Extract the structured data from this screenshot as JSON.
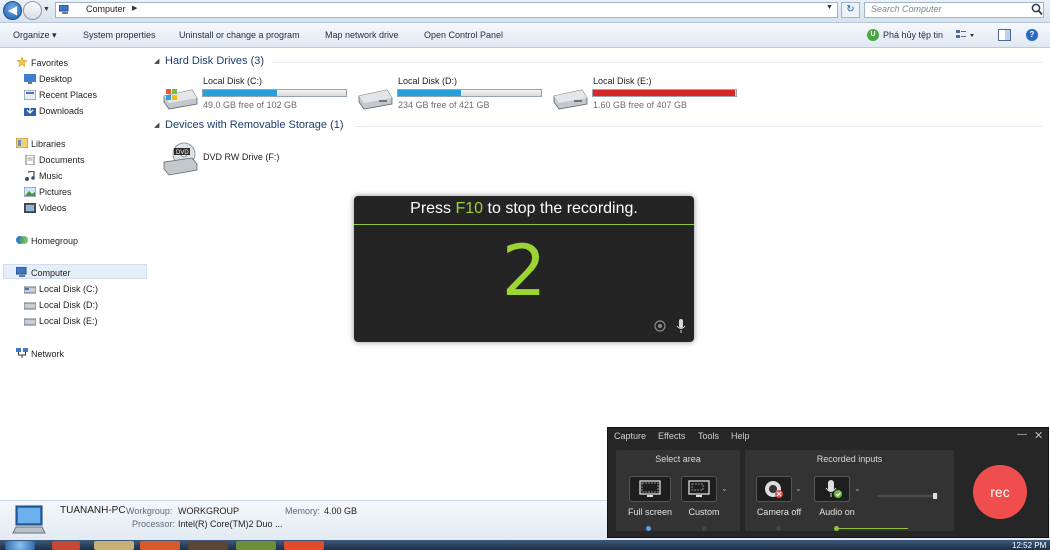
{
  "address_bar": {
    "path": "Computer",
    "search_placeholder": "Search Computer"
  },
  "command_bar": {
    "organize": "Organize",
    "system_properties": "System properties",
    "uninstall": "Uninstall or change a program",
    "map_drive": "Map network drive",
    "control_panel": "Open Control Panel",
    "extra": "Phá hủy tệp tin"
  },
  "nav": {
    "favorites": "Favorites",
    "desktop": "Desktop",
    "recent_places": "Recent Places",
    "downloads": "Downloads",
    "libraries": "Libraries",
    "documents": "Documents",
    "music": "Music",
    "pictures": "Pictures",
    "videos": "Videos",
    "homegroup": "Homegroup",
    "computer": "Computer",
    "disk_c": "Local Disk (C:)",
    "disk_d": "Local Disk (D:)",
    "disk_e": "Local Disk (E:)",
    "network": "Network"
  },
  "content": {
    "hard_disk_title": "Hard Disk Drives (3)",
    "removable_title": "Devices with Removable Storage (1)",
    "drives": [
      {
        "name": "Local Disk (C:)",
        "free": "49.0 GB free of 102 GB",
        "used_fraction": 0.52,
        "color": "#26a0da"
      },
      {
        "name": "Local Disk (D:)",
        "free": "234 GB free of 421 GB",
        "used_fraction": 0.44,
        "color": "#26a0da"
      },
      {
        "name": "Local Disk (E:)",
        "free": "1.60 GB free of 407 GB",
        "used_fraction": 0.996,
        "color": "#da2626"
      }
    ],
    "dvd_name": "DVD RW Drive (F:)",
    "dvd_label": "DVD"
  },
  "status": {
    "pc_name": "TUANANH-PC",
    "workgroup_label": "Workgroup:",
    "workgroup_value": "WORKGROUP",
    "memory_label": "Memory:",
    "memory_value": "4.00 GB",
    "processor_label": "Processor:",
    "processor_value": "Intel(R) Core(TM)2 Duo ..."
  },
  "taskbar": {
    "clock": "12:52 PM"
  },
  "countdown": {
    "prefix": "Press",
    "key": "F10",
    "suffix": "to stop the recording.",
    "number": "2"
  },
  "recorder": {
    "menu": [
      "Capture",
      "Effects",
      "Tools",
      "Help"
    ],
    "select_area_title": "Select area",
    "recorded_inputs_title": "Recorded inputs",
    "full_screen": "Full screen",
    "custom": "Custom",
    "camera": "Camera off",
    "audio": "Audio on",
    "rec": "rec",
    "audio_level": 0.95,
    "accent_color": "#8fc63d",
    "rec_color": "#f04e4e"
  }
}
